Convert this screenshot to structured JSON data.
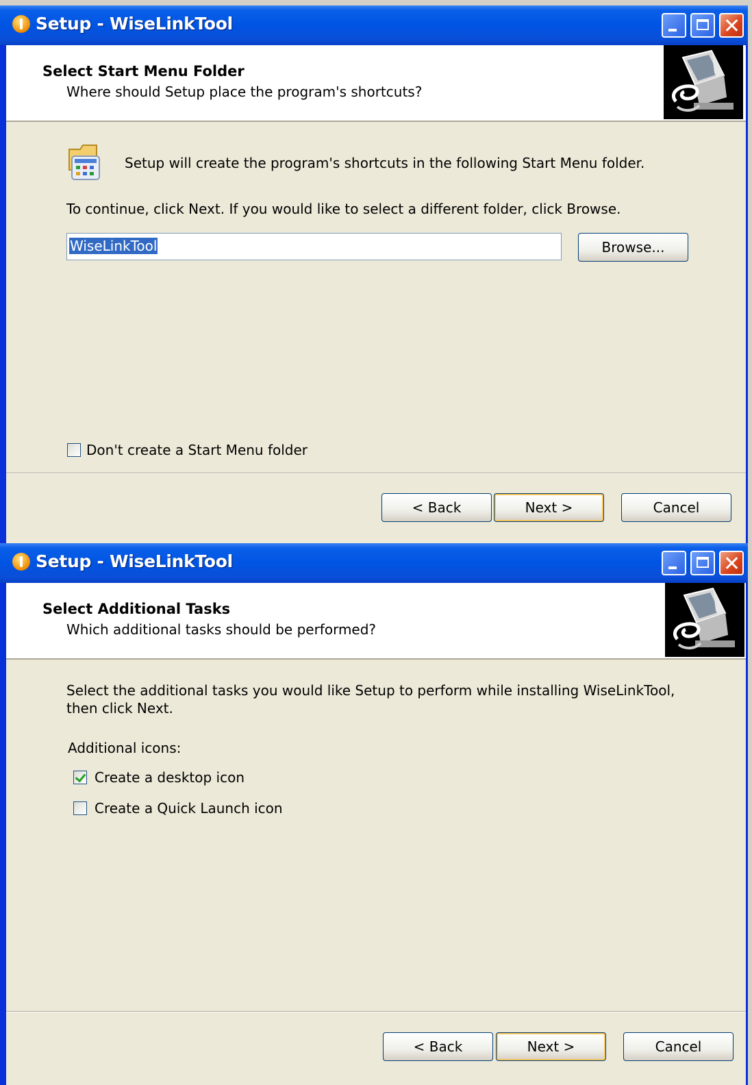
{
  "colors": {
    "titlebar": "#0054e3",
    "face": "#ece9d8",
    "selection": "#316ac5",
    "close_button": "#d8431c"
  },
  "window1": {
    "title": "Setup - WiseLinkTool",
    "header_title": "Select Start Menu Folder",
    "header_subtitle": "Where should Setup place the program's shortcuts?",
    "info_text": "Setup will create the program's shortcuts in the following Start Menu folder.",
    "instruction": "To continue, click Next. If you would like to select a different folder, click Browse.",
    "folder_value": "WiseLinkTool",
    "browse_label": "Browse...",
    "no_folder_label": "Don't create a Start Menu folder",
    "no_folder_checked": false,
    "back_label": "< Back",
    "next_label": "Next >",
    "cancel_label": "Cancel",
    "icons": {
      "app": "setup-icon",
      "folder": "start-menu-folder-icon",
      "wizard": "computer-wizard-icon"
    }
  },
  "window2": {
    "title": "Setup - WiseLinkTool",
    "header_title": "Select Additional Tasks",
    "header_subtitle": "Which additional tasks should be performed?",
    "info_line1": "Select the additional tasks you would like Setup to perform while installing WiseLinkTool,",
    "info_line2": "then click Next.",
    "group_label": "Additional icons:",
    "tasks": [
      {
        "label": "Create a desktop icon",
        "checked": true
      },
      {
        "label": "Create a Quick Launch icon",
        "checked": false
      }
    ],
    "back_label": "< Back",
    "next_label": "Next >",
    "cancel_label": "Cancel"
  }
}
